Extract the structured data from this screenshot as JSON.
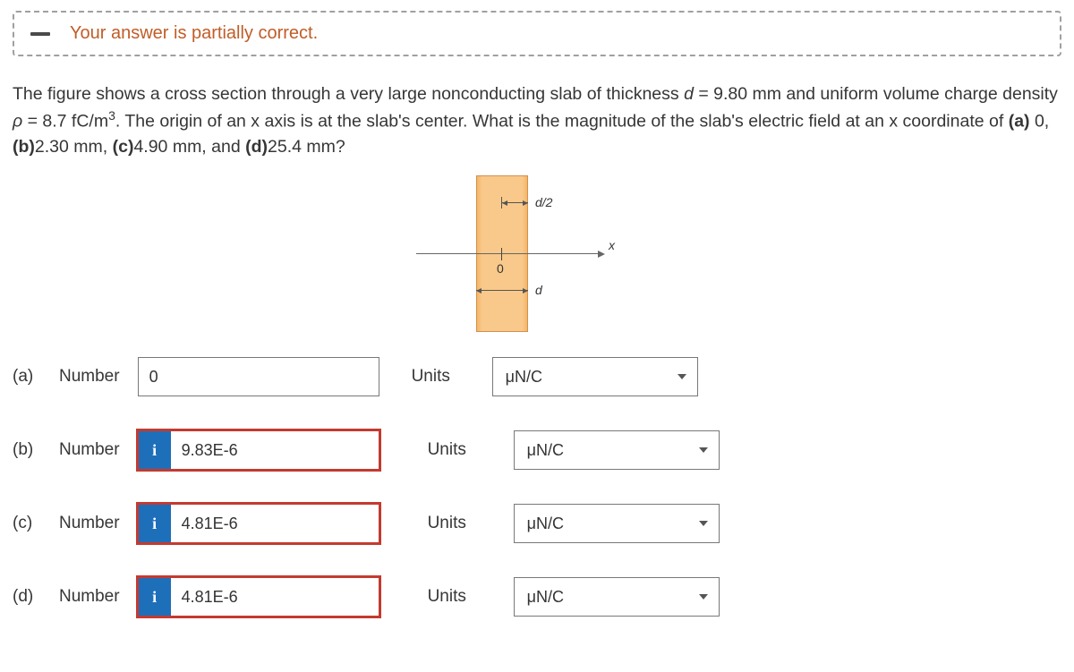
{
  "feedback": {
    "message": "Your answer is partially correct."
  },
  "question": {
    "text_parts": {
      "p1": "The figure shows a cross section through a very large nonconducting slab of thickness ",
      "d_var": "d",
      "eq1": " = 9.80 mm and uniform volume charge density ",
      "rho": "ρ",
      "eq2": " = 8.7 fC/m",
      "sup3": "3",
      "p2": ". The origin of an x axis is at the slab's center. What is the magnitude of the slab's electric field at an x coordinate of ",
      "a": "(a)",
      "av": " 0, ",
      "b": "(b)",
      "bv": "2.30 mm, ",
      "c": "(c)",
      "cv": "4.90 mm, and ",
      "d": "(d)",
      "dv": "25.4 mm?"
    }
  },
  "figure": {
    "d2_label": "d/2",
    "d_label": "d",
    "x_label": "x",
    "zero_label": "0"
  },
  "labels": {
    "number": "Number",
    "units": "Units",
    "info": "i"
  },
  "answers": {
    "a": {
      "part": "(a)",
      "value": "0",
      "units": "μN/C",
      "has_info": false,
      "incorrect": false
    },
    "b": {
      "part": "(b)",
      "value": "9.83E-6",
      "units": "μN/C",
      "has_info": true,
      "incorrect": true
    },
    "c": {
      "part": "(c)",
      "value": "4.81E-6",
      "units": "μN/C",
      "has_info": true,
      "incorrect": true
    },
    "d": {
      "part": "(d)",
      "value": "4.81E-6",
      "units": "μN/C",
      "has_info": true,
      "incorrect": true
    }
  }
}
